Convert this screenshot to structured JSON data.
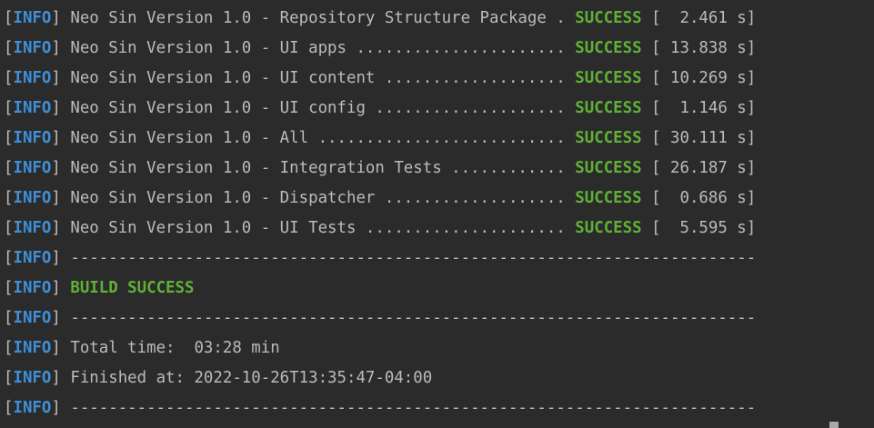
{
  "console": {
    "level_open": "[",
    "level_label": "INFO",
    "level_close": "]",
    "status_label": "SUCCESS",
    "modules": [
      {
        "name": "Neo Sin Version 1.0 - Repository Structure Package .",
        "time": "[  2.461 s]"
      },
      {
        "name": "Neo Sin Version 1.0 - UI apps ......................",
        "time": "[ 13.838 s]"
      },
      {
        "name": "Neo Sin Version 1.0 - UI content ...................",
        "time": "[ 10.269 s]"
      },
      {
        "name": "Neo Sin Version 1.0 - UI config ....................",
        "time": "[  1.146 s]"
      },
      {
        "name": "Neo Sin Version 1.0 - All ..........................",
        "time": "[ 30.111 s]"
      },
      {
        "name": "Neo Sin Version 1.0 - Integration Tests ............",
        "time": "[ 26.187 s]"
      },
      {
        "name": "Neo Sin Version 1.0 - Dispatcher ...................",
        "time": "[  0.686 s]"
      },
      {
        "name": "Neo Sin Version 1.0 - UI Tests .....................",
        "time": "[  5.595 s]"
      }
    ],
    "separator": "------------------------------------------------------------------------",
    "build_result": "BUILD SUCCESS",
    "total_time": "Total time:  03:28 min",
    "finished_at": "Finished at: 2022-10-26T13:35:47-04:00"
  },
  "colors": {
    "background": "#2b2b2b",
    "text": "#bbbbbb",
    "info": "#3e8fd8",
    "success": "#5fb135"
  }
}
